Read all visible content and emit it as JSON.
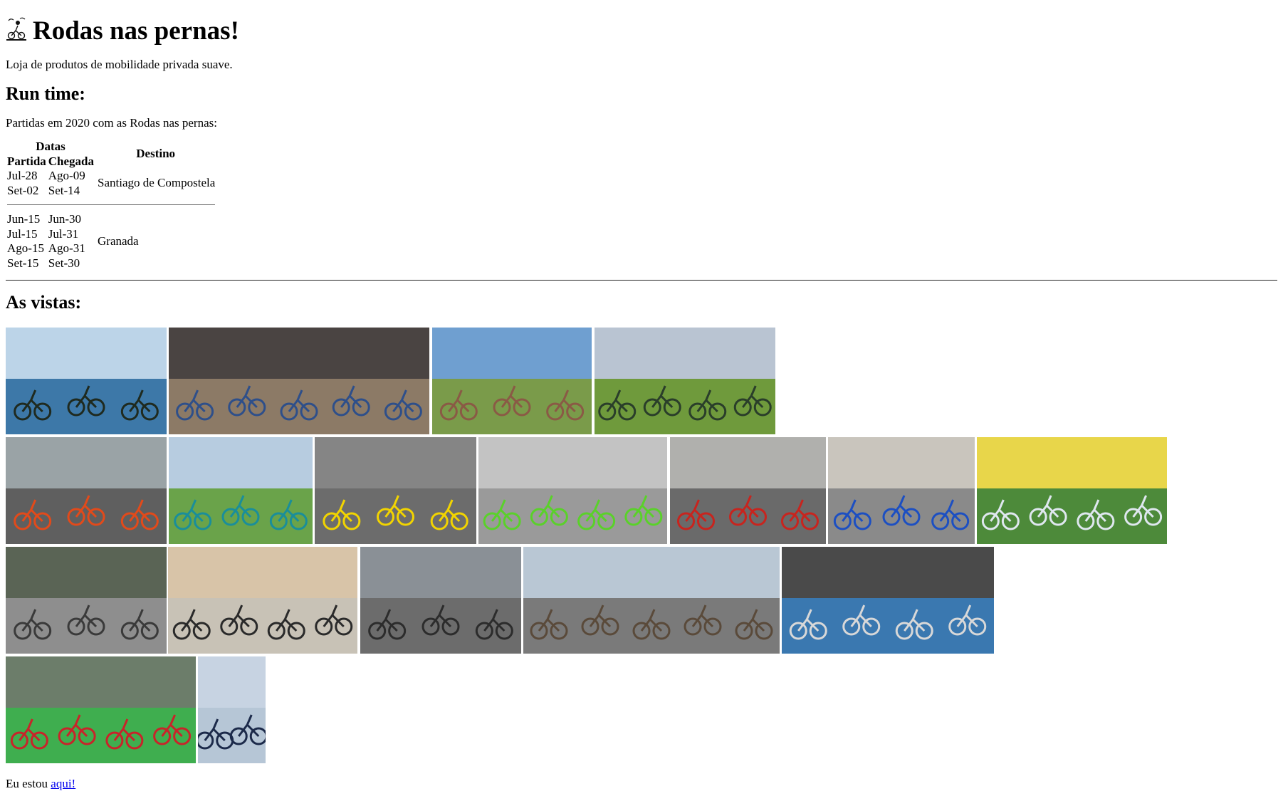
{
  "header": {
    "logo_icon": "cyclist-icon",
    "title": "Rodas nas pernas!",
    "tagline": "Loja de produtos de mobilidade privada suave."
  },
  "run_time": {
    "heading": "Run time:",
    "intro": "Partidas em 2020 com as Rodas nas pernas:",
    "table": {
      "group_header": "Datas",
      "col_departure": "Partida",
      "col_arrival": "Chegada",
      "col_destination": "Destino",
      "groups": [
        {
          "destination": "Santiago de Compostela",
          "rows": [
            {
              "departure": "Jul-28",
              "arrival": "Ago-09"
            },
            {
              "departure": "Set-02",
              "arrival": "Set-14"
            }
          ]
        },
        {
          "destination": "Granada",
          "rows": [
            {
              "departure": "Jun-15",
              "arrival": "Jun-30"
            },
            {
              "departure": "Jul-15",
              "arrival": "Jul-31"
            },
            {
              "departure": "Ago-15",
              "arrival": "Ago-31"
            },
            {
              "departure": "Set-15",
              "arrival": "Set-30"
            }
          ]
        }
      ]
    }
  },
  "gallery": {
    "heading": "As vistas:",
    "rows": [
      [
        {
          "name": "photo-cyclists-by-sea",
          "sky": "#bcd4e8",
          "ground": "#3d78a8",
          "accent": "#1f2a1f"
        },
        {
          "name": "photo-mountain-bikers-trail",
          "sky": "#4a4442",
          "ground": "#8c7a66",
          "accent": "#2e4f8a"
        },
        {
          "name": "photo-stupa-cyclists",
          "sky": "#6f9fd0",
          "ground": "#7a9b4a",
          "accent": "#8a5a45"
        },
        {
          "name": "photo-cyclists-at-lake",
          "sky": "#b9c4d2",
          "ground": "#6f9a3c",
          "accent": "#2a3e2a"
        }
      ],
      [
        {
          "name": "photo-orange-shared-bikes",
          "sky": "#9aa3a6",
          "ground": "#5f5f5f",
          "accent": "#e24a1a"
        },
        {
          "name": "photo-teal-shared-bikes",
          "sky": "#b7cce0",
          "ground": "#6aa34a",
          "accent": "#1a8e9a"
        },
        {
          "name": "photo-yellow-shared-bikes",
          "sky": "#858585",
          "ground": "#6c6c6c",
          "accent": "#f2d400"
        },
        {
          "name": "photo-green-shared-bike",
          "sky": "#c3c3c3",
          "ground": "#9a9a9a",
          "accent": "#5ad12a"
        },
        {
          "name": "photo-red-ecobici-bikes",
          "sky": "#b0b0ad",
          "ground": "#6a6a6a",
          "accent": "#c8241e"
        },
        {
          "name": "photo-blue-bike-station",
          "sky": "#c9c5bd",
          "ground": "#8a8a8a",
          "accent": "#1c4fc2"
        },
        {
          "name": "photo-white-bikes-turf",
          "sky": "#e8d64a",
          "ground": "#4d8a3a",
          "accent": "#dfe7ef"
        }
      ],
      [
        {
          "name": "photo-bike-parking-lot",
          "sky": "#5a6455",
          "ground": "#8e8e8e",
          "accent": "#3a3a3a"
        },
        {
          "name": "photo-underground-bike-parking",
          "sky": "#d8c4a8",
          "ground": "#c8c2b6",
          "accent": "#2a2a2a"
        },
        {
          "name": "photo-double-deck-bike-rack",
          "sky": "#8a9096",
          "ground": "#6c6c6c",
          "accent": "#2c2c2c"
        },
        {
          "name": "photo-city-street-cyclists",
          "sky": "#b9c7d4",
          "ground": "#7a7a7a",
          "accent": "#5a4a3a"
        },
        {
          "name": "photo-commuter-cyclists-crowd",
          "sky": "#4a4a4a",
          "ground": "#3a78b0",
          "accent": "#d8d8d8"
        }
      ],
      [
        {
          "name": "photo-scooter-riders-lane",
          "sky": "#6c7d6a",
          "ground": "#3fae4f",
          "accent": "#c8242a"
        },
        {
          "name": "photo-businessmen-scooters",
          "sky": "#c7d3e2",
          "ground": "#b6c6d6",
          "accent": "#1c2a4a"
        }
      ]
    ]
  },
  "footer": {
    "text": "Eu estou ",
    "link_label": "aqui!"
  }
}
